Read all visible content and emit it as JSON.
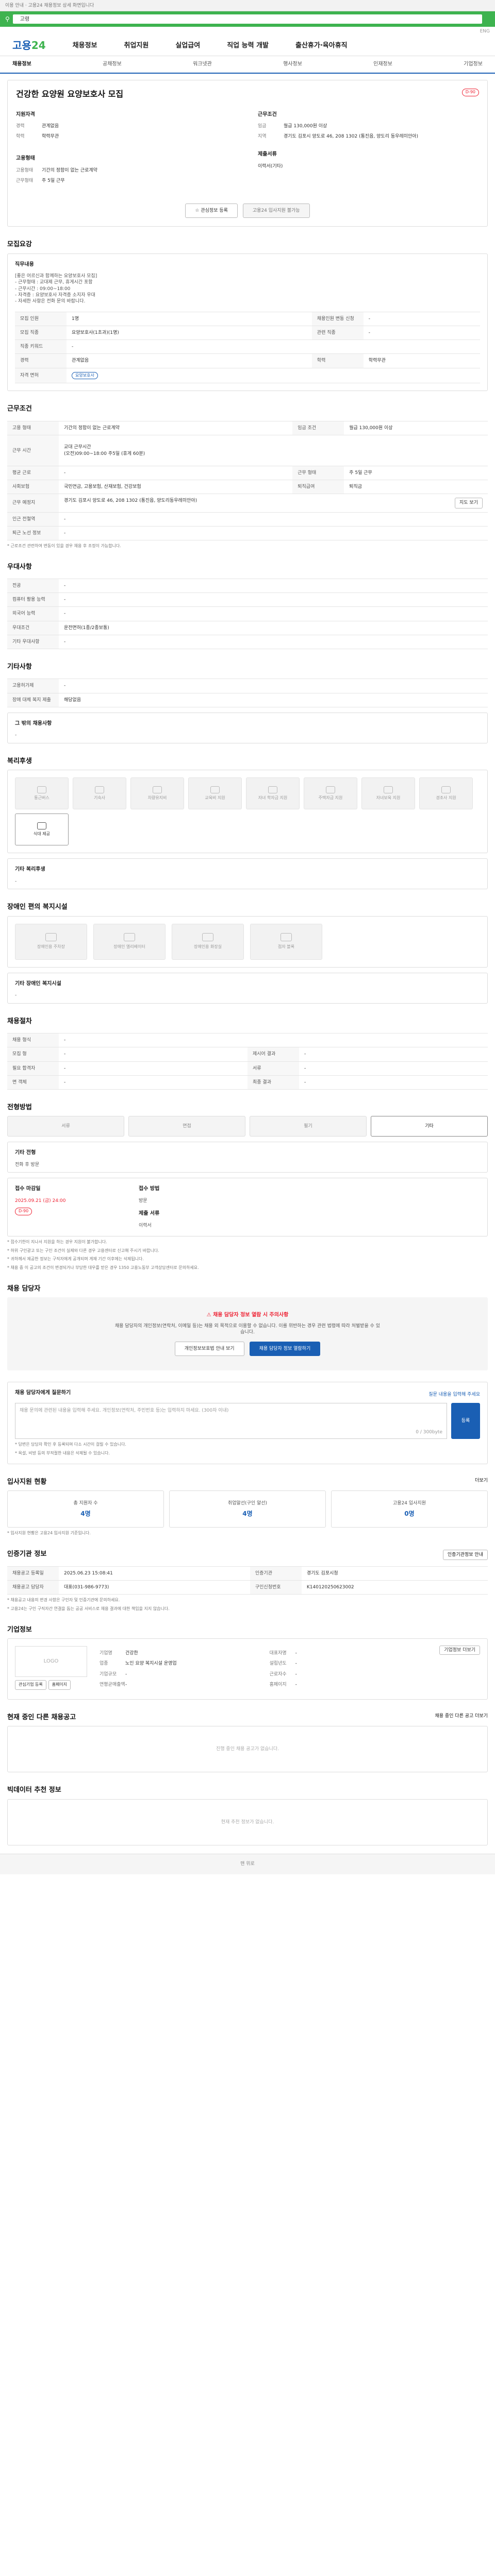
{
  "top": {
    "notice": "이용 안내 · 고용24 채용정보 상세 화면입니다",
    "search": "고령",
    "lang": "ENG"
  },
  "logo": {
    "main": "고용",
    "accent": "24"
  },
  "nav": [
    "채용정보",
    "취업지원",
    "실업급여",
    "직업 능력 개발",
    "출산휴가·육아휴직"
  ],
  "subnav": [
    "채용정보",
    "공채정보",
    "워크넷관",
    "행사정보",
    "인재정보",
    "기업정보"
  ],
  "job": {
    "title": "건강한 요양원 요양보호사 모집",
    "badge": "D-90",
    "left_label": "지원자격",
    "left": [
      {
        "k": "경력",
        "v": "관계없음"
      },
      {
        "k": "학력",
        "v": "학력무관"
      }
    ],
    "left_label2": "고용형태",
    "left2": [
      {
        "k": "고용형태",
        "v": "기간의 정함이 없는 근로계약"
      },
      {
        "k": "근무형태",
        "v": "주 5일 근무"
      }
    ],
    "right_label": "근무조건",
    "right": [
      {
        "k": "임금",
        "v": "월급 130,000원 이상"
      },
      {
        "k": "지역",
        "v": "경기도 김포시 양도로 46, 208 1302 (통진읍, 양도리 동우레미안아)"
      }
    ],
    "right_label2": "제출서류",
    "right2": [
      {
        "k": "",
        "v": "이력서(기타)"
      }
    ],
    "btn1": "관심정보 등록",
    "btn2": "고용24 입사지원 불가능"
  },
  "recruit": {
    "title": "모집요강",
    "desc_title": "직무내용",
    "desc": "[좋은 어르신과 함께하는 요양보호사 모집]\n- 근무형태 : 교대제 근무, 휴게시간 포함\n- 근무시간 : 09:00~18:00\n- 자격증 : 요양보호사 자격증 소지자 우대\n- 자세한 사항은 전화 문의 바랍니다.",
    "rows": [
      [
        {
          "k": "모집 인원",
          "v": "1명"
        },
        {
          "k": "채용인원 변동 신청",
          "v": "-"
        }
      ],
      [
        {
          "k": "모집 직종",
          "v": "요양보호사(1초과)(1명)"
        },
        {
          "k": "관련 직종",
          "v": "-"
        }
      ],
      [
        {
          "k": "직종 키워드",
          "v": "-",
          "full": true
        }
      ],
      [
        {
          "k": "경력",
          "v": "관계없음"
        },
        {
          "k": "학력",
          "v": "학력무관"
        }
      ],
      [
        {
          "k": "자격 면허",
          "v": "요양보호사"
        },
        {
          "k": "",
          "v": ""
        }
      ]
    ]
  },
  "conditions": {
    "title": "근무조건",
    "rows": [
      [
        {
          "k": "고용 형태",
          "v": "기간의 정함이 없는 근로계약"
        },
        {
          "k": "임금 조건",
          "v": "월급 130,000원 이상"
        }
      ],
      [
        {
          "k": "근무 시간",
          "v": "교대 근무시간\n(오전)09:00~18:00 주5일 (휴게 60분)"
        },
        {
          "k": "",
          "v": ""
        }
      ],
      [
        {
          "k": "평균 근로",
          "v": "-"
        },
        {
          "k": "근무 형태",
          "v": "주 5일 근무"
        }
      ],
      [
        {
          "k": "사회보험",
          "v": "국민연금, 고용보험, 산재보험, 건강보험"
        },
        {
          "k": "퇴직급여",
          "v": "퇴직금"
        }
      ],
      [
        {
          "k": "근무 예정지",
          "v": "경기도 김포시 양도로 46, 208 1302 (통진읍, 양도리동우레미안아)",
          "full": true
        }
      ],
      [
        {
          "k": "인근 전철역",
          "v": "-",
          "full": true
        }
      ],
      [
        {
          "k": "퇴근 노선 정보",
          "v": "-",
          "full": true
        }
      ]
    ],
    "map_btn": "지도 보기",
    "note": "* 근로조건 관련하여 변동이 있을 경우 채용 후 조정이 가능합니다."
  },
  "preferred": {
    "title": "우대사항",
    "rows": [
      {
        "k": "전공",
        "v": "-"
      },
      {
        "k": "컴퓨터 활용 능력",
        "v": "-"
      },
      {
        "k": "외국어 능력",
        "v": "-"
      },
      {
        "k": "우대조건",
        "v": "운전면허(1종/2종보통)"
      },
      {
        "k": "기타 우대사항",
        "v": "-"
      }
    ]
  },
  "etc": {
    "title": "기타사항",
    "rows": [
      {
        "k": "고용허가제",
        "v": "-"
      },
      {
        "k": "장애 대체 복지 제출",
        "v": "해당없음"
      }
    ],
    "other_title": "그 밖의 채용사항",
    "other": "-"
  },
  "welfare": {
    "title": "복리후생",
    "tiles": [
      {
        "label": "통근버스",
        "on": false
      },
      {
        "label": "기숙사",
        "on": false
      },
      {
        "label": "차량유지비",
        "on": false
      },
      {
        "label": "교육비 지원",
        "on": false
      },
      {
        "label": "자녀 학자금 지원",
        "on": false
      },
      {
        "label": "주택자금 지원",
        "on": false
      },
      {
        "label": "자녀보육 지원",
        "on": false
      },
      {
        "label": "경조사 지원",
        "on": false
      },
      {
        "label": "식대 제공",
        "on": true
      }
    ],
    "other_title": "기타 복리후생",
    "other": "-"
  },
  "disability": {
    "title": "장애인 편의 복지시설",
    "tiles": [
      "장애인용 주차장",
      "장애인 엘리베이터",
      "장애인용 화장실",
      "점자 블록"
    ],
    "other_title": "기타 장애인 복지시설",
    "other": "-"
  },
  "hiring": {
    "title": "채용절차",
    "rows": [
      [
        {
          "k": "채용 형식",
          "v": "-"
        },
        {
          "k": "",
          "v": ""
        }
      ],
      [
        {
          "k": "모집 형",
          "v": "-"
        },
        {
          "k": "제시어 결과",
          "v": "-"
        }
      ],
      [
        {
          "k": "필요 합격자",
          "v": "-"
        },
        {
          "k": "서류",
          "v": "-"
        }
      ],
      [
        {
          "k": "면 객체",
          "v": "-"
        },
        {
          "k": "최종 결과",
          "v": "-"
        }
      ]
    ]
  },
  "process": {
    "title": "전형방법",
    "steps": [
      "서류",
      "면접",
      "필기",
      "기타"
    ],
    "active": 3,
    "other_title": "기타 전형",
    "other": "전화 후 방문",
    "date_label": "접수 마감일",
    "date": "2025.09.21 (금) 24:00",
    "date_tag": "D-90",
    "method_label": "접수 방법",
    "method": "방문",
    "doc_label": "제출 서류",
    "doc": "이력서",
    "notes": [
      "* 접수기한이 지나서 지원을 하는 경우 지원이 불가합니다.",
      "* 허위 구인광고 또는 구인 조건이 실제와 다른 경우 고용센터로 신고해 주시기 바랍니다.",
      "* 귀하께서 제공한 정보는 구직자에게 공개되며 게재 기간 이후에는 삭제됩니다.",
      "* 채용 중 이 공고의 조건이 변경되거나 부당한 대우를 받은 경우 1350 고용노동부 고객상담센터로 문의하세요."
    ]
  },
  "contact": {
    "title": "채용 담당자",
    "alert": "채용 담당자 정보 열람 시 주의사항",
    "alert_text": "채용 담당자의 개인정보(연락처, 이메일 등)는 채용 외 목적으로 이용할 수 없습니다. 이를 위반하는 경우 관련 법령에 따라 처벌받을 수 있습니다.",
    "btn1": "개인정보보호법 안내 보기",
    "btn2": "채용 담당자 정보 열람하기"
  },
  "inquiry": {
    "title": "채용 담당자에게 질문하기",
    "sub": "질문 내용을 입력해 주세요",
    "placeholder": "채용 문의에 관련된 내용을 입력해 주세요. 개인정보(연락처, 주민번호 등)는 입력하지 마세요. (300자 이내)",
    "count": "0 / 300byte",
    "btn": "등록",
    "notes": [
      "* 답변은 담당자 확인 후 등록되며 다소 시간이 걸릴 수 있습니다.",
      "* 욕설, 비방 등의 부적절한 내용은 삭제될 수 있습니다."
    ]
  },
  "applicants": {
    "title": "입사지원 현황",
    "more": "더보기",
    "stats": [
      {
        "label": "총 지원자 수",
        "n": "4명"
      },
      {
        "label": "취업알선(구인 알선)",
        "n": "4명"
      },
      {
        "label": "고용24 입사지원",
        "n": "0명"
      }
    ],
    "note": "* 입사지원 현황은 고용24 입사지원 기준입니다."
  },
  "auth": {
    "title": "인증기관 정보",
    "btn": "인증기관정보 안내",
    "rows": [
      [
        {
          "k": "채용공고 등록일",
          "v": "2025.06.23 15:08:41"
        },
        {
          "k": "인증기관",
          "v": "경기도 김포시청"
        }
      ],
      [
        {
          "k": "채용공고 담당자",
          "v": "대표(031-986-9773)"
        },
        {
          "k": "구인신청번호",
          "v": "K140120250623002"
        }
      ]
    ],
    "notes": [
      "* 채용공고 내용의 변경 사항은 구인자 및 인증기관에 문의하세요.",
      "* 고용24는 구인 구직자간 연결을 돕는 공공 서비스로 채용 결과에 대한 책임을 지지 않습니다."
    ]
  },
  "company": {
    "title": "기업정보",
    "logo": "LOGO",
    "b1": "관심기업 등록",
    "b2": "홈페이지",
    "cols": [
      [
        {
          "k": "기업명",
          "v": "건강한"
        },
        {
          "k": "업종",
          "v": "노인 요양 복지시설 운영업"
        },
        {
          "k": "기업규모",
          "v": "-"
        },
        {
          "k": "연평균매출액",
          "v": "-"
        }
      ],
      [
        {
          "k": "대표자명",
          "v": "-"
        },
        {
          "k": "설립년도",
          "v": "-"
        },
        {
          "k": "근로자수",
          "v": "-"
        },
        {
          "k": "홈페이지",
          "v": "-"
        }
      ]
    ],
    "btn": "기업정보 더보기"
  },
  "other_jobs": {
    "title": "현재 중인 다른 채용공고",
    "empty": "진행 중인 채용 공고가 없습니다.",
    "more": "채용 중인 다른 공고 더보기"
  },
  "recommend": {
    "title": "빅데이터 추천 정보",
    "empty": "현재 추천 정보가 없습니다."
  },
  "footer": "맨 위로"
}
